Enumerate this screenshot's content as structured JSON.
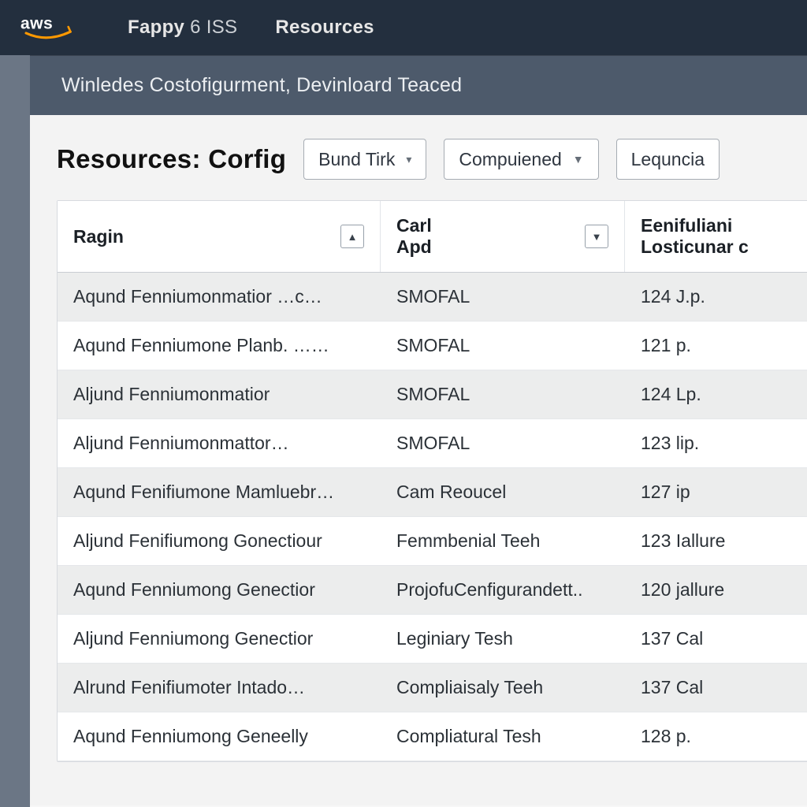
{
  "colors": {
    "nav_bg": "#232f3e",
    "strip_bg": "#4d5a6b",
    "accent": "#ff9900"
  },
  "topnav": {
    "logo_text": "aws",
    "item1_main": "Fappy",
    "item1_sub": "6 ISS",
    "item2": "Resources"
  },
  "breadcrumb": "Winledes Costofigurment, Devinloard Teaced",
  "page": {
    "title_a": "Resources:",
    "title_b": "Corfig"
  },
  "filters": [
    {
      "label": "Bund Tirk"
    },
    {
      "label": "Compuiened"
    },
    {
      "label": "Lequncia"
    }
  ],
  "columns": [
    {
      "label": "Ragin",
      "sort": "asc"
    },
    {
      "label": "Carl\nApd",
      "sort": "desc"
    },
    {
      "label": "Eenifuliani\nLosticunar c"
    }
  ],
  "rows": [
    {
      "c0": "Aqund Fenniumonmatior …c…",
      "c1": "SMOFAL",
      "c2": "124 J.p."
    },
    {
      "c0": "Aqund Fenniumone Planb. ……",
      "c1": "SMOFAL",
      "c2": "121 p."
    },
    {
      "c0": "Aljund Fenniumonmatior",
      "c1": "SMOFAL",
      "c2": "124 Lp."
    },
    {
      "c0": "Aljund Fenniumonmattor…",
      "c1": "SMOFAL",
      "c2": "123 lip."
    },
    {
      "c0": "Aqund Fenifiumone Mamluebr…",
      "c1": "Cam Reoucel",
      "c2": "127 ip"
    },
    {
      "c0": "Aljund Fenifiumong Gonectiour",
      "c1": "Femmbenial Teeh",
      "c2": "123 Iallure"
    },
    {
      "c0": "Aqund Fenniumong Genectior",
      "c1": "ProjofuCenfigurandett..",
      "c2": "120 jallure"
    },
    {
      "c0": "Aljund Fenniumong Genectior",
      "c1": "Leginiary Tesh",
      "c2": "137 Cal"
    },
    {
      "c0": "Alrund Fenifiumoter Intado…",
      "c1": "Compliaisaly Teeh",
      "c2": "137 Cal"
    },
    {
      "c0": "Aqund Fenniumong Geneelly",
      "c1": "Compliatural Tesh",
      "c2": "128 p."
    }
  ]
}
